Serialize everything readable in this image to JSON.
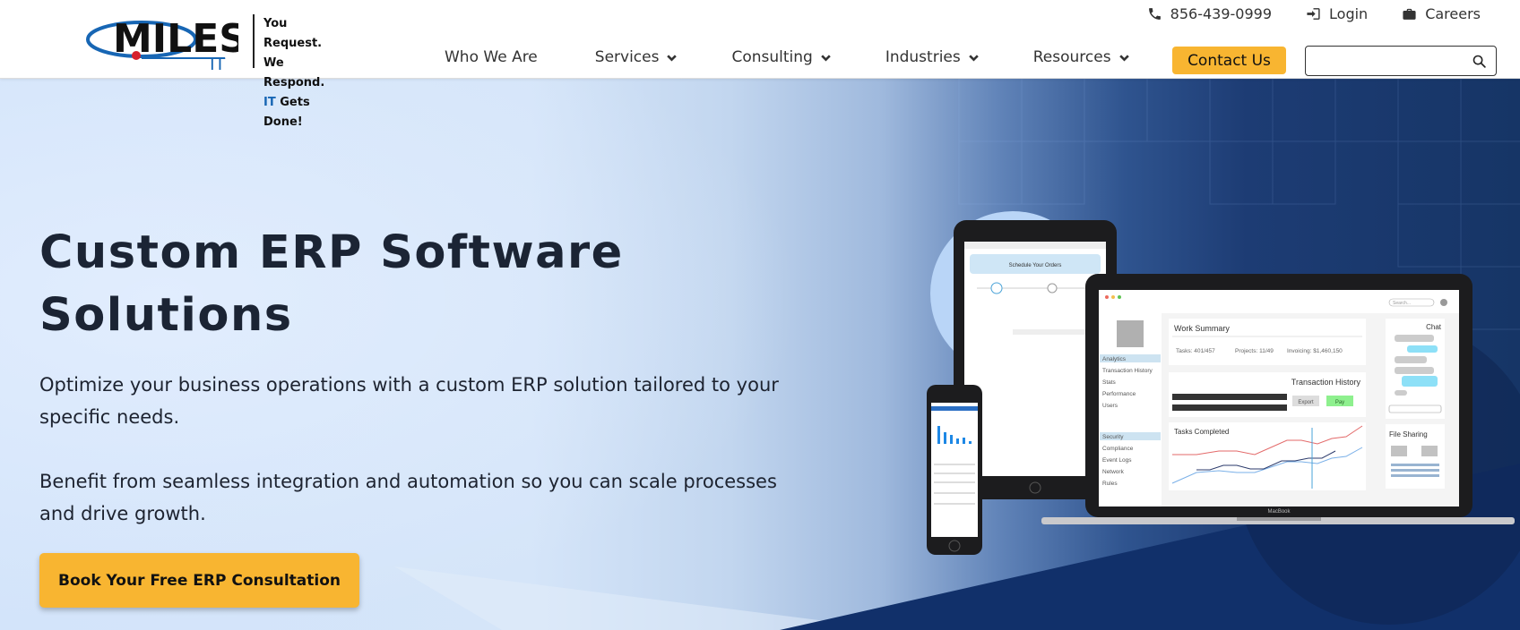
{
  "header": {
    "logo": {
      "word": "MILES",
      "sub": "IT",
      "tagline": [
        "You Request.",
        "We Respond.",
        "IT",
        "Gets Done!"
      ]
    },
    "utility": [
      {
        "icon": "phone-icon",
        "label": "856-439-0999"
      },
      {
        "icon": "login-icon",
        "label": "Login"
      },
      {
        "icon": "briefcase-icon",
        "label": "Careers"
      }
    ],
    "nav": [
      {
        "label": "Who We Are",
        "dropdown": false
      },
      {
        "label": "Services",
        "dropdown": true
      },
      {
        "label": "Consulting",
        "dropdown": true
      },
      {
        "label": "Industries",
        "dropdown": true
      },
      {
        "label": "Resources",
        "dropdown": true
      }
    ],
    "contact_label": "Contact Us",
    "search_placeholder": "",
    "search_icon": "search-icon"
  },
  "hero": {
    "title_line1": "Custom ERP Software",
    "title_line2": "Solutions",
    "para1": "Optimize your business operations with a custom ERP solution tailored to your specific needs.",
    "para2": "Benefit from seamless integration and automation so you can scale processes and drive growth.",
    "cta_label": "Book Your Free ERP Consultation"
  },
  "mockup": {
    "tablet_title": "Schedule Your Orders",
    "laptop": {
      "search_placeholder": "Search...",
      "sidebar": [
        "Analytics",
        "Transaction History",
        "Stats",
        "Performance",
        "Users",
        "Security",
        "Compliance",
        "Event Logs",
        "Network",
        "Rules"
      ],
      "work_summary_title": "Work Summary",
      "work_summary_stats": [
        "Tasks: 401/457",
        "Projects: 11/49",
        "Invoicing: $1,460,150"
      ],
      "transaction_title": "Transaction History",
      "export_label": "Export",
      "pay_label": "Pay",
      "tasks_title": "Tasks Completed",
      "chat_title": "Chat",
      "file_sharing_title": "File Sharing",
      "brand": "MacBook"
    }
  },
  "colors": {
    "accent": "#f8b531",
    "logo_blue": "#1766b4",
    "logo_red": "#d6202d",
    "text_dark": "#1b2434",
    "hero_dark": "#163566"
  }
}
